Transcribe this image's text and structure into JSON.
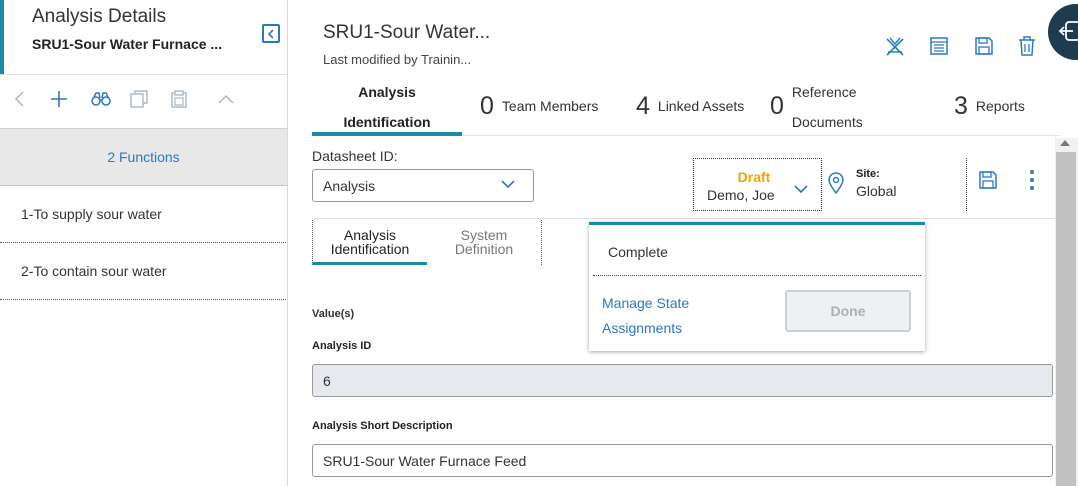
{
  "left_panel": {
    "title": "Analysis Details",
    "subtitle": "SRU1-Sour Water Furnace ...",
    "functions_header": "2 Functions",
    "functions": [
      {
        "label": "1-To supply sour water"
      },
      {
        "label": "2-To contain sour water"
      }
    ],
    "toolbar_icons": [
      "chevron-left-icon",
      "plus-icon",
      "binoculars-icon",
      "copy-icon",
      "paste-icon",
      "chevron-up-icon"
    ]
  },
  "header": {
    "title": "SRU1-Sour Water...",
    "last_modified": "Last modified by Trainin...",
    "action_icons": [
      "asset-hierarchy-icon",
      "datasheet-icon",
      "save-icon",
      "delete-icon"
    ]
  },
  "summary": {
    "active_tab": {
      "line1": "Analysis",
      "line2": "Identification"
    },
    "items": [
      {
        "count": "0",
        "label": "Team Members"
      },
      {
        "count": "4",
        "label": "Linked Assets"
      },
      {
        "count": "0",
        "label_line1": "Reference",
        "label_line2": "Documents"
      },
      {
        "count": "3",
        "label": "Reports"
      }
    ]
  },
  "datasheet": {
    "label": "Datasheet ID:",
    "value": "Analysis"
  },
  "state": {
    "status": "Draft",
    "owner": "Demo, Joe",
    "status_color": "#f5a100"
  },
  "site": {
    "label": "Site:",
    "value": "Global"
  },
  "sub_tabs": [
    {
      "line1": "Analysis",
      "line2": "Identification",
      "active": true
    },
    {
      "line1": "System",
      "line2": "Definition",
      "active": false
    }
  ],
  "state_popup": {
    "option": "Complete",
    "link_line1": "Manage State",
    "link_line2": "Assignments",
    "done_label": "Done"
  },
  "form": {
    "values_label": "Value(s)",
    "analysis_id_label": "Analysis ID",
    "analysis_id_value": "6",
    "short_desc_label": "Analysis Short Description",
    "short_desc_value": "SRU1-Sour Water Furnace Feed"
  },
  "colors": {
    "accent": "#1a8ba3",
    "link": "#2b78c2",
    "draft": "#f5a100"
  }
}
